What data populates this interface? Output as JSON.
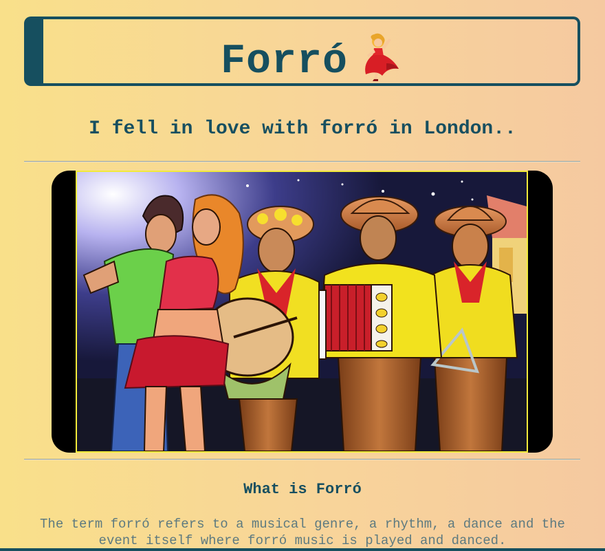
{
  "header": {
    "title": "Forró",
    "icon": "dancer-icon"
  },
  "subtitle": "I fell in love with forró in London..",
  "hero_image": {
    "description_icon": "forro-illustration"
  },
  "section": {
    "heading": "What is Forró",
    "text": "The term forró refers to a musical genre, a rhythm, a dance and the event itself where forró music is played and danced."
  },
  "colors": {
    "primary": "#164f5f",
    "background_start": "#f9e08a",
    "background_end": "#f5c9a0",
    "image_border": "#f2ea3a"
  }
}
